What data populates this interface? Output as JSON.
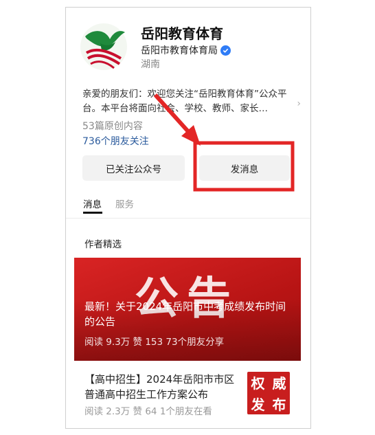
{
  "account": {
    "name": "岳阳教育体育",
    "org": "岳阳市教育体育局",
    "region": "湖南",
    "verified_icon": "verified-badge-icon",
    "logo_icon": "bird-logo-icon"
  },
  "description": "亲爱的朋友们：欢迎您关注“岳阳教育体育”公众平台。本平台将面向社会、学校、教师、家长…",
  "stats": {
    "articles": "53篇原创内容",
    "friends": "736个朋友关注"
  },
  "buttons": {
    "followed": "已关注公众号",
    "message": "发消息"
  },
  "tabs": [
    {
      "label": "消息",
      "active": true
    },
    {
      "label": "服务",
      "active": false
    }
  ],
  "section": {
    "title": "作者精选"
  },
  "articles": [
    {
      "banner_text": "公告",
      "title": "最新！关于2024年岳阳市中考成绩发布时间的公告",
      "meta": "阅读 9.3万  赞 153  73个朋友分享"
    },
    {
      "title": "【高中招生】2024年岳阳市市区普通高中招生工作方案公布",
      "meta": "阅读 2.3万  赞 64  1个朋友在看",
      "thumb": [
        "权",
        "威",
        "发",
        "布"
      ]
    }
  ],
  "colors": {
    "annotation_red": "#e32626",
    "link_blue": "#2a5a9c",
    "verified_blue": "#2f7cf6"
  }
}
